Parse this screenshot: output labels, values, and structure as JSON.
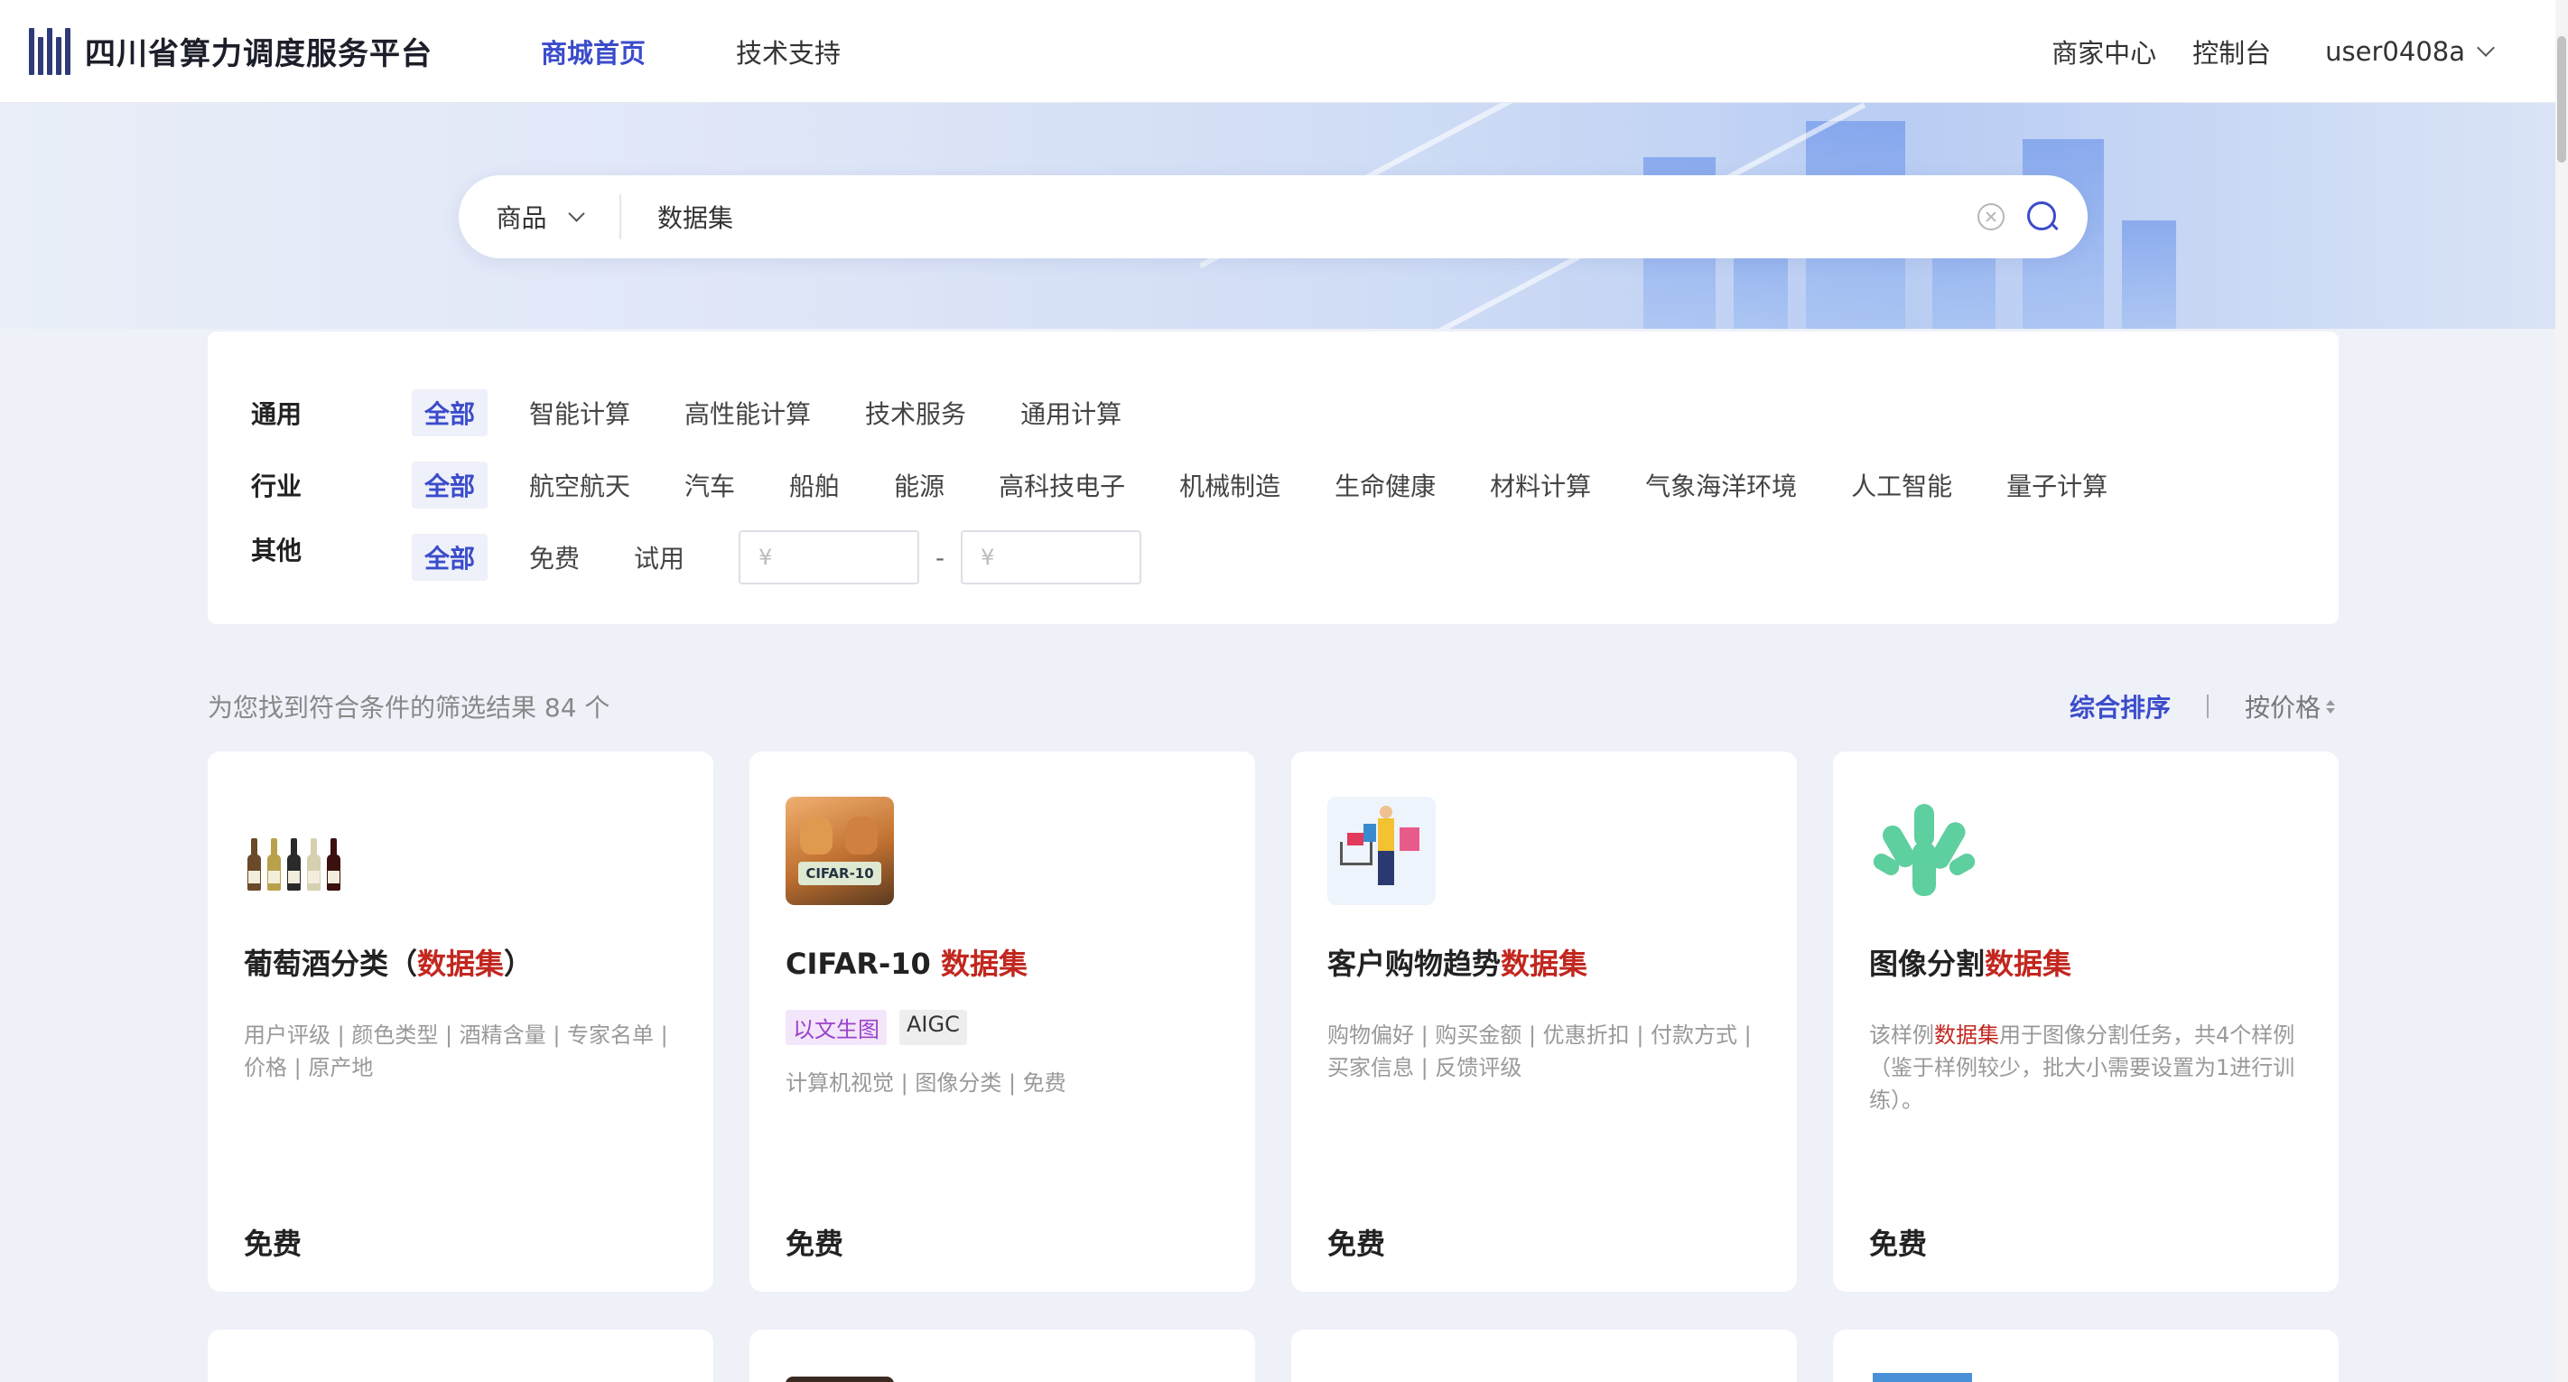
{
  "header": {
    "title": "四川省算力调度服务平台",
    "nav": [
      {
        "label": "商城首页",
        "active": true
      },
      {
        "label": "技术支持",
        "active": false
      }
    ],
    "right_links": [
      "商家中心",
      "控制台"
    ],
    "user": "user0408a",
    "accent_color": "#3b4cca"
  },
  "search": {
    "type": "商品",
    "value": "数据集"
  },
  "filters": {
    "general": {
      "label": "通用",
      "options": [
        "全部",
        "智能计算",
        "高性能计算",
        "技术服务",
        "通用计算"
      ]
    },
    "industry": {
      "label": "行业",
      "options": [
        "全部",
        "航空航天",
        "汽车",
        "船舶",
        "能源",
        "高科技电子",
        "机械制造",
        "生命健康",
        "材料计算",
        "气象海洋环境",
        "人工智能",
        "量子计算"
      ]
    },
    "other": {
      "label": "其他",
      "options": [
        "全部",
        "免费",
        "试用"
      ],
      "price_min_placeholder": "¥",
      "price_max_placeholder": "¥",
      "range_sep": "-"
    }
  },
  "results": {
    "count_text": "为您找到符合条件的筛选结果 84 个",
    "sort_default": "综合排序",
    "sort_price": "按价格"
  },
  "cards": [
    {
      "title_pre": "葡萄酒分类（",
      "title_hl": "数据集",
      "title_post": "）",
      "desc": "用户评级 | 颜色类型 | 酒精含量 | 专家名单 | 价格 | 原产地",
      "price": "免费"
    },
    {
      "title_pre": "CIFAR-10 ",
      "title_hl": "数据集",
      "title_post": "",
      "tags": [
        "以文生图",
        "AIGC"
      ],
      "desc": "计算机视觉 | 图像分类 | 免费",
      "price": "免费",
      "img_text": "CIFAR-10"
    },
    {
      "title_pre": "客户购物趋势",
      "title_hl": "数据集",
      "title_post": "",
      "desc": "购物偏好 | 购买金额 | 优惠折扣 | 付款方式 | 买家信息 | 反馈评级",
      "price": "免费"
    },
    {
      "title_pre": "图像分割",
      "title_hl": "数据集",
      "title_post": "",
      "desc_pre": "该样例",
      "desc_hl": "数据集",
      "desc_post": "用于图像分割任务，共4个样例（鉴于样例较少，批大小需要设置为1进行训练）。",
      "price": "免费"
    }
  ]
}
